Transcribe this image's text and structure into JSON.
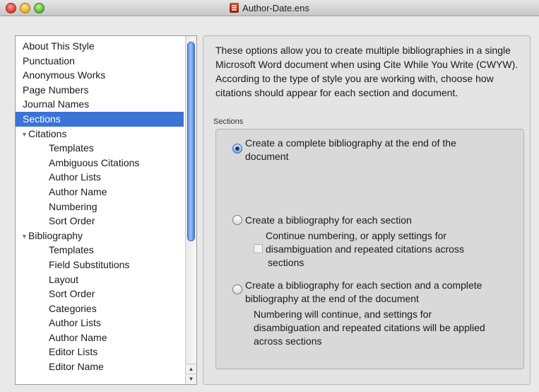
{
  "window": {
    "title": "Author-Date.ens"
  },
  "sidebar": {
    "items": [
      {
        "label": "About This Style",
        "level": 0
      },
      {
        "label": "Punctuation",
        "level": 0
      },
      {
        "label": "Anonymous Works",
        "level": 0
      },
      {
        "label": "Page Numbers",
        "level": 0
      },
      {
        "label": "Journal Names",
        "level": 0
      },
      {
        "label": "Sections",
        "level": 0,
        "selected": true
      },
      {
        "label": "Citations",
        "level": 0,
        "expanded": true
      },
      {
        "label": "Templates",
        "level": 1
      },
      {
        "label": "Ambiguous Citations",
        "level": 1
      },
      {
        "label": "Author Lists",
        "level": 1
      },
      {
        "label": "Author Name",
        "level": 1
      },
      {
        "label": "Numbering",
        "level": 1
      },
      {
        "label": "Sort Order",
        "level": 1
      },
      {
        "label": "Bibliography",
        "level": 0,
        "expanded": true
      },
      {
        "label": "Templates",
        "level": 1
      },
      {
        "label": "Field Substitutions",
        "level": 1
      },
      {
        "label": "Layout",
        "level": 1
      },
      {
        "label": "Sort Order",
        "level": 1
      },
      {
        "label": "Categories",
        "level": 1
      },
      {
        "label": "Author Lists",
        "level": 1
      },
      {
        "label": "Author Name",
        "level": 1
      },
      {
        "label": "Editor Lists",
        "level": 1
      },
      {
        "label": "Editor Name",
        "level": 1
      }
    ],
    "scroll_up_glyph": "▲",
    "scroll_down_glyph": "▼",
    "disclosure_glyph": "▼"
  },
  "panel": {
    "description": "These options allow you to create multiple bibliographies in a single Microsoft Word document when using Cite While You Write (CWYW). According to the type of style you are working with, choose how citations should appear for each section and document.",
    "group_label": "Sections",
    "option1": {
      "line1": "Create a complete bibliography at the end of the",
      "line2": "document",
      "checked": true
    },
    "option2": {
      "label": "Create a bibliography for each section",
      "checked": false
    },
    "option2_sub": {
      "line1": "Continue numbering, or apply settings for",
      "line2": "disambiguation and repeated citations across",
      "line3": "sections",
      "enabled": false
    },
    "option3": {
      "line1": "Create a bibliography for each section and a complete",
      "line2": "bibliography at the end of the document",
      "checked": false
    },
    "option3_note": {
      "line1": "Numbering will continue, and settings for",
      "line2": "disambiguation and repeated citations will be applied",
      "line3": "across sections"
    }
  },
  "colors": {
    "selection": "#3b73d6",
    "scroll_thumb": "#5d8fe3"
  }
}
